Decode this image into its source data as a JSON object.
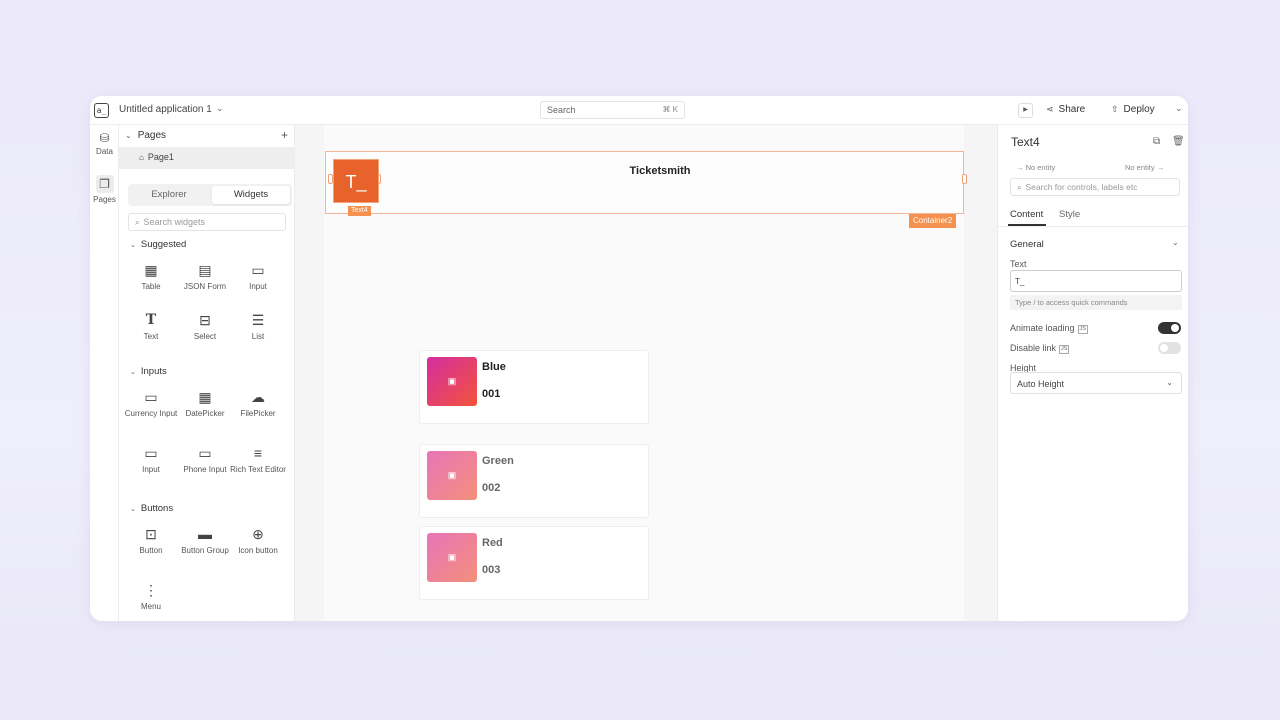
{
  "header": {
    "logo": "a_",
    "app_title": "Untitled application 1",
    "search_label": "Search",
    "search_shortcut": "⌘ K",
    "share_label": "Share",
    "deploy_label": "Deploy"
  },
  "rail": {
    "data_label": "Data",
    "pages_label": "Pages"
  },
  "left_panel": {
    "pages_header": "Pages",
    "page_item": "Page1",
    "tabs": {
      "explorer": "Explorer",
      "widgets": "Widgets"
    },
    "search_placeholder": "Search widgets",
    "suggested_header": "Suggested",
    "suggested": [
      "Table",
      "JSON Form",
      "Input",
      "Text",
      "Select",
      "List"
    ],
    "inputs_header": "Inputs",
    "inputs": [
      "Currency Input",
      "DatePicker",
      "FilePicker",
      "Input",
      "Phone Input",
      "Rich Text Editor"
    ],
    "buttons_header": "Buttons",
    "buttons": [
      "Button",
      "Button Group",
      "Icon button",
      "Menu"
    ]
  },
  "canvas": {
    "container_tag": "Container2",
    "text_widget_value": "T_",
    "text_widget_tag": "Text4",
    "title": "Ticketsmith",
    "cards": [
      {
        "name": "Blue",
        "number": "001"
      },
      {
        "name": "Green",
        "number": "002"
      },
      {
        "name": "Red",
        "number": "003"
      }
    ]
  },
  "right_panel": {
    "widget_name": "Text4",
    "entity_left": "No entity",
    "entity_right": "No entity",
    "search_placeholder": "Search for controls, labels etc",
    "tabs": {
      "content": "Content",
      "style": "Style"
    },
    "section": "General",
    "text_label": "Text",
    "text_value": "T_",
    "hint": "Type / to access quick commands",
    "animate_loading": "Animate loading",
    "animate_loading_on": true,
    "disable_link": "Disable link",
    "disable_link_on": false,
    "js_badge": "JS",
    "height_label": "Height",
    "height_value": "Auto Height"
  },
  "colors": {
    "accent_orange": "#e8622b",
    "tag_orange": "#f4914e",
    "toggle_on": "#333333",
    "toggle_off": "#e2e2e2"
  }
}
